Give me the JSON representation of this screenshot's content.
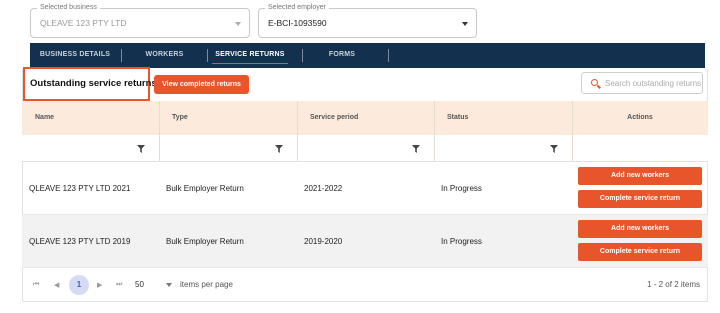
{
  "selectors": {
    "business": {
      "label": "Selected business",
      "value": "QLEAVE 123 PTY LTD"
    },
    "employer": {
      "label": "Selected employer",
      "value": "E-BCI-1093590"
    }
  },
  "nav": {
    "tabs": [
      {
        "label": "BUSINESS DETAILS"
      },
      {
        "label": "WORKERS"
      },
      {
        "label": "SERVICE RETURNS",
        "active": true
      },
      {
        "label": "FORMS"
      }
    ]
  },
  "section": {
    "title": "Outstanding service returns",
    "view_completed_label": "View completed returns",
    "search_placeholder": "Search outstanding returns"
  },
  "table": {
    "columns": [
      "Name",
      "Type",
      "Service period",
      "Status",
      "Actions"
    ],
    "rows": [
      {
        "name": "QLEAVE 123 PTY LTD 2021",
        "type": "Bulk Employer Return",
        "period": "2021-2022",
        "status": "In Progress"
      },
      {
        "name": "QLEAVE 123 PTY LTD 2019",
        "type": "Bulk Employer Return",
        "period": "2019-2020",
        "status": "In Progress"
      }
    ],
    "actions": {
      "add_workers": "Add new workers",
      "complete_return": "Complete service return"
    }
  },
  "pager": {
    "first": "⏮",
    "prev": "◀",
    "next": "▶",
    "last": "⏭",
    "current_page": "1",
    "page_size": "50",
    "page_size_label": "items per page",
    "range_text": "1 - 2 of 2 items"
  },
  "colors": {
    "accent": "#e9552b",
    "nav_bg": "#13304f",
    "header_bg": "#fcebdc",
    "pager_active": "#d5dbf4"
  }
}
